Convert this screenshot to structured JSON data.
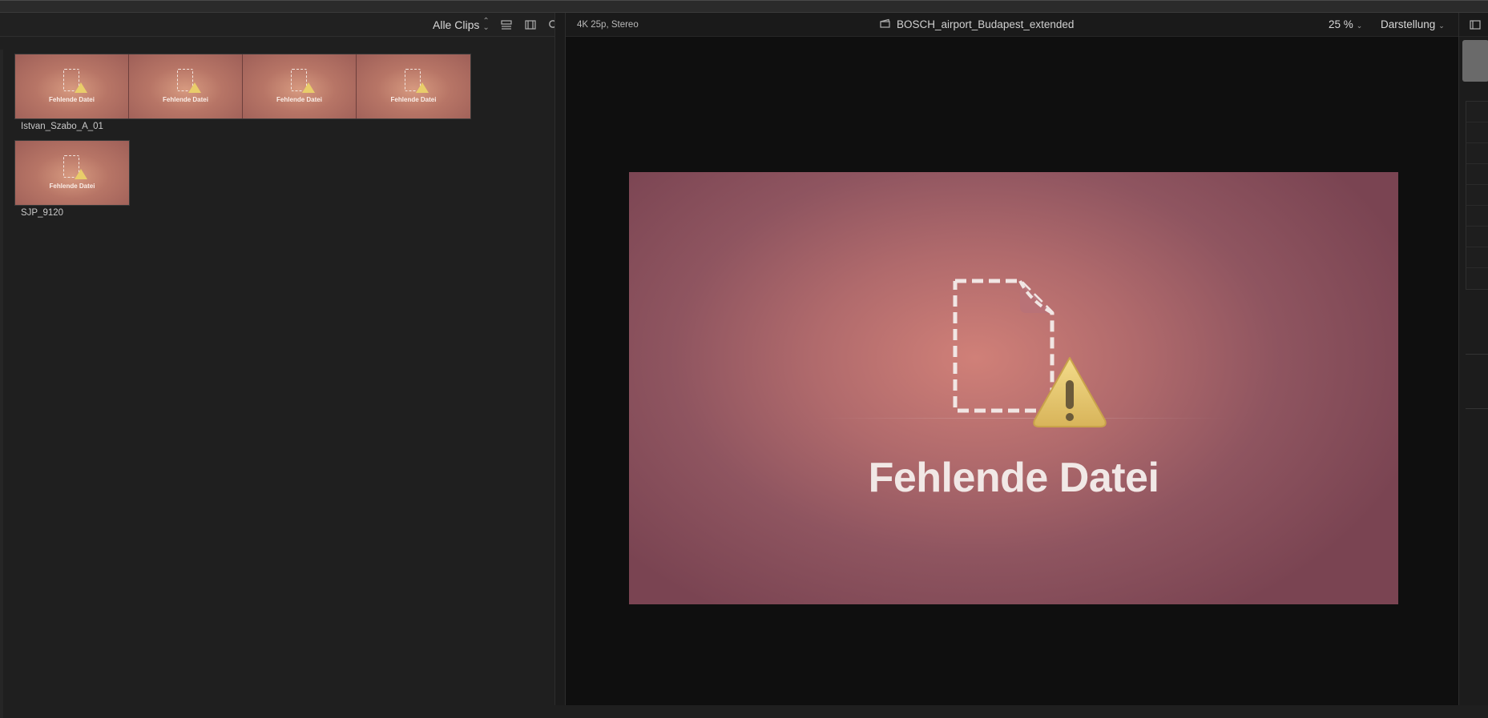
{
  "browser": {
    "filter_label": "Alle Clips",
    "clips": [
      {
        "name": "Istvan_Szabo_A_01",
        "thumbnail_count": 4,
        "thumbnail_label": "Fehlende Datei"
      },
      {
        "name": "SJP_9120",
        "thumbnail_count": 1,
        "thumbnail_label": "Fehlende Datei"
      }
    ]
  },
  "viewer": {
    "format": "4K 25p, Stereo",
    "project_title": "BOSCH_airport_Budapest_extended",
    "zoom": "25 %",
    "view_menu": "Darstellung",
    "missing_file_text": "Fehlende Datei"
  },
  "icons": {
    "filter": "updown-chevron-icon",
    "list_view": "list-view-icon",
    "filmstrip_view": "filmstrip-view-icon",
    "search": "search-icon",
    "project": "clapperboard-icon",
    "inspector": "inspector-filmstrip-icon"
  },
  "colors": {
    "warning_yellow": "#e9cd6a",
    "frame_pink": "#b06a6c"
  }
}
